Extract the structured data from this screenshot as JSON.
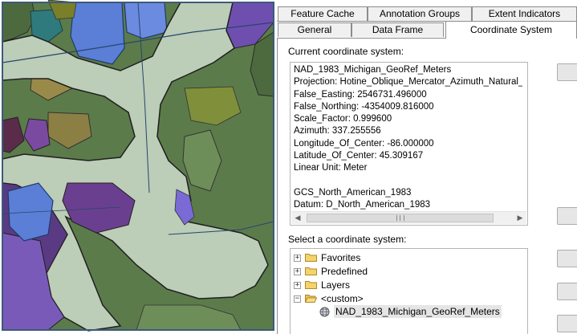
{
  "tabs_row1": [
    "Feature Cache",
    "Annotation Groups",
    "Extent Indicators"
  ],
  "tabs_row2": [
    "General",
    "Data Frame",
    "Coordinate System"
  ],
  "active_tab": "Coordinate System",
  "current_cs_label": "Current coordinate system:",
  "current_cs_text": "NAD_1983_Michigan_GeoRef_Meters\nProjection: Hotine_Oblique_Mercator_Azimuth_Natural_Origin\nFalse_Easting: 2546731.496000\nFalse_Northing: -4354009.816000\nScale_Factor: 0.999600\nAzimuth: 337.255556\nLongitude_Of_Center: -86.000000\nLatitude_Of_Center: 45.309167\nLinear Unit: Meter\n\nGCS_North_American_1983\nDatum: D_North_American_1983",
  "select_cs_label": "Select a coordinate system:",
  "tree": {
    "favorites": "Favorites",
    "predefined": "Predefined",
    "layers": "Layers",
    "custom": "<custom>",
    "custom_item": "NAD_1983_Michigan_GeoRef_Meters"
  },
  "scroll_marks": {
    "left": "◀",
    "right": "▶"
  },
  "colors": {
    "map_background": "#5b7a4a",
    "floodplain": "#bccdb8",
    "water_blue": "#5b7fd6",
    "purple": "#6b3f8f",
    "selected_tab": "#ffffff"
  }
}
